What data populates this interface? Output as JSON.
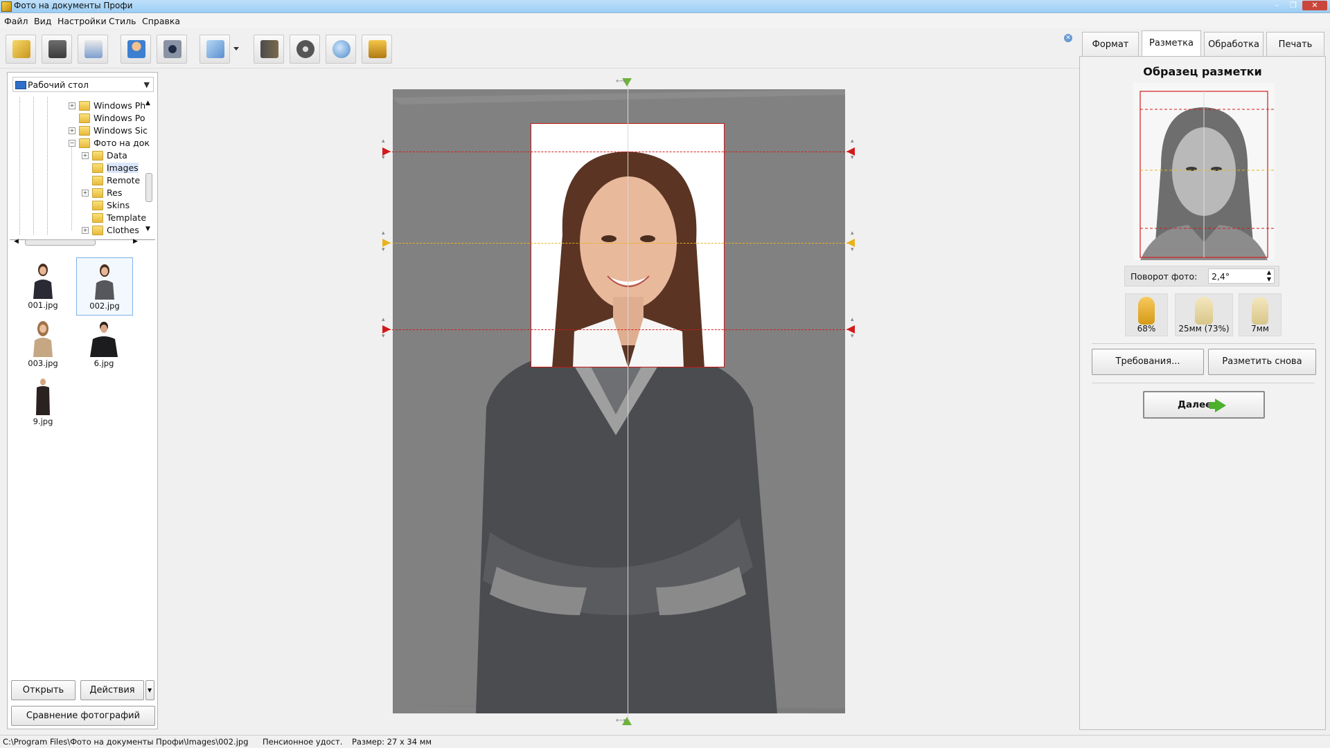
{
  "window": {
    "title": "Фото на документы Профи"
  },
  "menu": [
    "Файл",
    "Вид",
    "Настройки",
    "Стиль",
    "Справка"
  ],
  "left": {
    "location": "Рабочий стол",
    "tree": [
      {
        "name": "Windows Ph",
        "expander": "+"
      },
      {
        "name": "Windows Po",
        "expander": ""
      },
      {
        "name": "Windows Sic",
        "expander": "+"
      },
      {
        "name": "Фото на док",
        "expander": "−"
      },
      {
        "name": "Data",
        "expander": "+"
      },
      {
        "name": "Images",
        "expander": ""
      },
      {
        "name": "Remote",
        "expander": ""
      },
      {
        "name": "Res",
        "expander": "+"
      },
      {
        "name": "Skins",
        "expander": ""
      },
      {
        "name": "Template",
        "expander": ""
      },
      {
        "name": "Clothes",
        "expander": "+"
      }
    ],
    "thumbnails": [
      "001.jpg",
      "002.jpg",
      "003.jpg",
      "6.jpg",
      "9.jpg"
    ],
    "open_button": "Открыть",
    "actions_button": "Действия",
    "compare_button": "Сравнение фотографий"
  },
  "tabs": [
    "Формат",
    "Разметка",
    "Обработка",
    "Печать"
  ],
  "right": {
    "sample_title": "Образец разметки",
    "rotate_label": "Поворот фото:",
    "rotate_value": "2,4°",
    "tiles": [
      "68%",
      "25мм (73%)",
      "7мм"
    ],
    "requirements_button": "Требования...",
    "remark_button": "Разметить снова",
    "next_button": "Далее"
  },
  "status": {
    "path": "C:\\Program Files\\Фото на документы Профи\\Images\\002.jpg",
    "format": "Пенсионное удост.",
    "size": "Размер: 27 х 34 мм"
  },
  "colors": {
    "accent_red": "#d21a1a",
    "guide_yellow": "#e8b21c",
    "canvas_gray": "#818181"
  }
}
